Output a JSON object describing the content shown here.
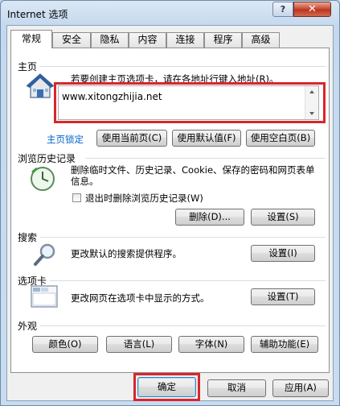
{
  "window": {
    "title": "Internet 选项",
    "help_label": "?",
    "close_label": "✕"
  },
  "tabs": [
    "常规",
    "安全",
    "隐私",
    "内容",
    "连接",
    "程序",
    "高级"
  ],
  "homepage": {
    "group_label": "主页",
    "description": "若要创建主页选项卡，请在各地址行键入地址(R)。",
    "url_value": "www.xitongzhijia.net",
    "locked_link": "主页锁定",
    "use_current": "使用当前页(C)",
    "use_default": "使用默认值(F)",
    "use_blank": "使用空白页(B)"
  },
  "history": {
    "group_label": "浏览历史记录",
    "description": "删除临时文件、历史记录、Cookie、保存的密码和网页表单信息。",
    "checkbox_label": "退出时删除浏览历史记录(W)",
    "delete_label": "删除(D)...",
    "settings_label": "设置(S)"
  },
  "search": {
    "group_label": "搜索",
    "description": "更改默认的搜索提供程序。",
    "settings_label": "设置(I)"
  },
  "tabs_section": {
    "group_label": "选项卡",
    "description": "更改网页在选项卡中显示的方式。",
    "settings_label": "设置(T)"
  },
  "appearance": {
    "group_label": "外观",
    "colors_label": "颜色(O)",
    "languages_label": "语言(L)",
    "fonts_label": "字体(N)",
    "accessibility_label": "辅助功能(E)"
  },
  "footer": {
    "ok_label": "确定",
    "cancel_label": "取消",
    "apply_label": "应用(A)"
  },
  "accent_red": "#d9262c"
}
